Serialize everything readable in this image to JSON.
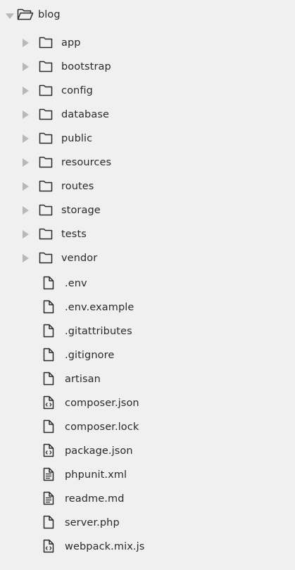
{
  "colors": {
    "background": "#f0f0f0",
    "text": "#2a2a2a",
    "icon": "#2a2a2a",
    "arrow": "#b8b8b8"
  },
  "tree": {
    "root": {
      "label": "blog",
      "expanded": true,
      "icon": "folder-open-icon"
    },
    "folders": [
      {
        "label": "app",
        "icon": "folder-icon"
      },
      {
        "label": "bootstrap",
        "icon": "folder-icon"
      },
      {
        "label": "config",
        "icon": "folder-icon"
      },
      {
        "label": "database",
        "icon": "folder-icon"
      },
      {
        "label": "public",
        "icon": "folder-icon"
      },
      {
        "label": "resources",
        "icon": "folder-icon"
      },
      {
        "label": "routes",
        "icon": "folder-icon"
      },
      {
        "label": "storage",
        "icon": "folder-icon"
      },
      {
        "label": "tests",
        "icon": "folder-icon"
      },
      {
        "label": "vendor",
        "icon": "folder-icon"
      }
    ],
    "files": [
      {
        "label": ".env",
        "icon": "file-icon"
      },
      {
        "label": ".env.example",
        "icon": "file-icon"
      },
      {
        "label": ".gitattributes",
        "icon": "file-icon"
      },
      {
        "label": ".gitignore",
        "icon": "file-icon"
      },
      {
        "label": "artisan",
        "icon": "file-icon"
      },
      {
        "label": "composer.json",
        "icon": "file-code-icon"
      },
      {
        "label": "composer.lock",
        "icon": "file-icon"
      },
      {
        "label": "package.json",
        "icon": "file-code-icon"
      },
      {
        "label": "phpunit.xml",
        "icon": "file-text-icon"
      },
      {
        "label": "readme.md",
        "icon": "file-text-icon"
      },
      {
        "label": "server.php",
        "icon": "file-icon"
      },
      {
        "label": "webpack.mix.js",
        "icon": "file-code-icon"
      }
    ]
  }
}
